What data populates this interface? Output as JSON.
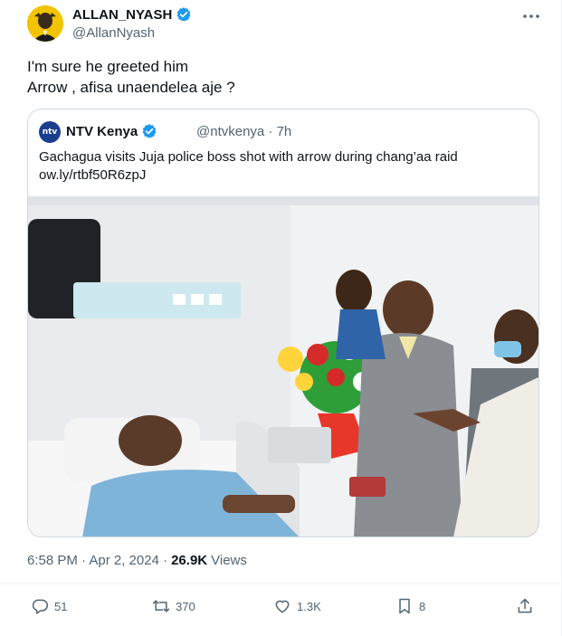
{
  "author": {
    "name": "ALLAN_NYASH",
    "handle": "@AllanNyash",
    "avatar_icon": "avatar-icon",
    "verified_icon": "verified-badge-icon"
  },
  "tweet": {
    "lines": [
      "I'm sure he greeted him",
      "Arrow , afisa unaendelea aje ?"
    ]
  },
  "quoted": {
    "name": "NTV Kenya",
    "avatar_text": "ntv",
    "handle_time": "@ntvkenya · 7h",
    "text_line1": "Gachagua visits Juja police boss shot with arrow during chang’aa raid",
    "text_line2": "ow.ly/rtbf50R6zpJ",
    "image_alt": "photo-of-hospital-visit"
  },
  "meta": {
    "time": "6:58 PM · Apr 2, 2024 ·",
    "views_count": "26.9K",
    "views_label": "Views"
  },
  "actions": {
    "replies": "51",
    "retweets": "370",
    "likes": "1.3K",
    "bookmarks": "8"
  },
  "colors": {
    "verified": "#1d9bf0",
    "secondary_text": "#536471",
    "border": "#cfd9de"
  }
}
